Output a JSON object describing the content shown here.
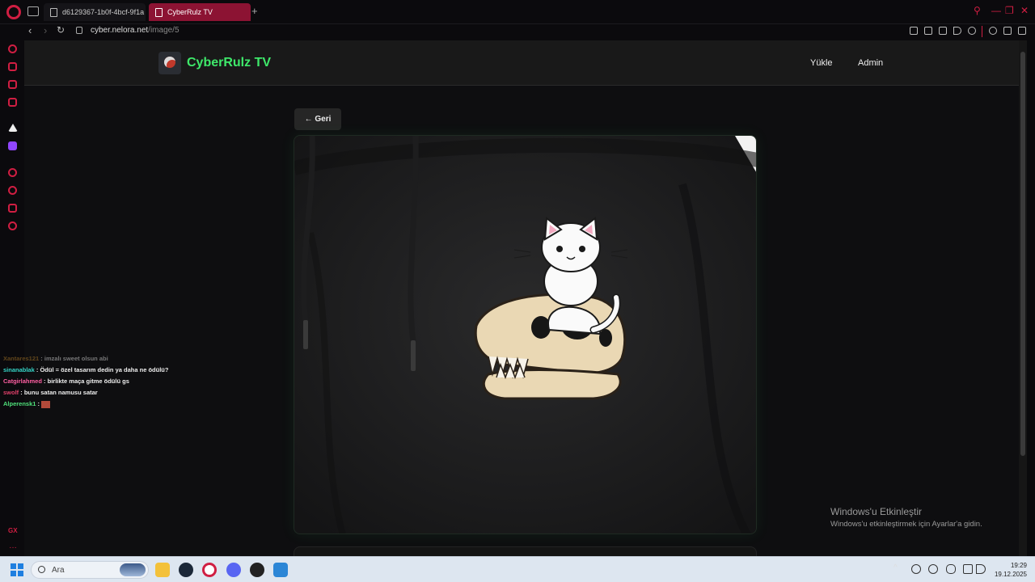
{
  "browser": {
    "tabs": [
      {
        "title": "d6129367-1b0f-4bcf-9f1a",
        "active": false
      },
      {
        "title": "CyberRulz TV",
        "active": true
      }
    ],
    "url_host": "cyber.nelora.net",
    "url_path": "/image/5",
    "accent_color": "#d01e42"
  },
  "site": {
    "title": "CyberRulz TV",
    "nav": {
      "upload": "Yükle",
      "admin": "Admin"
    },
    "back_label": "← Geri",
    "title_color": "#3ee86a"
  },
  "chat": [
    {
      "user": "Xantares121",
      "message": ": imzalı sweet olsun abi",
      "color": "#c58a2a"
    },
    {
      "user": "sinanablak",
      "message": ": Ödül = özel tasarım dedin ya daha ne ödülü?",
      "color": "#35d6c8"
    },
    {
      "user": "Catgirlahmed",
      "message": ": birlikte maça gitme ödülü gs",
      "color": "#ff5fa2"
    },
    {
      "user": "swolf",
      "message": ": bunu satan namusu satar",
      "color": "#e0406a"
    },
    {
      "user": "Alperensk1",
      "message": ":",
      "color": "#4fe07a"
    }
  ],
  "windows": {
    "activation_title": "Windows'u Etkinleştir",
    "activation_sub": "Windows'u etkinleştirmek için Ayarlar'a gidin.",
    "search_placeholder": "Ara",
    "time": "19:29",
    "date": "19.12.2025"
  },
  "icons": [
    "opera-icon",
    "tab-switcher-icon",
    "lock-icon",
    "back-icon",
    "forward-icon",
    "reload-icon",
    "search-icon",
    "windows-start-icon"
  ]
}
